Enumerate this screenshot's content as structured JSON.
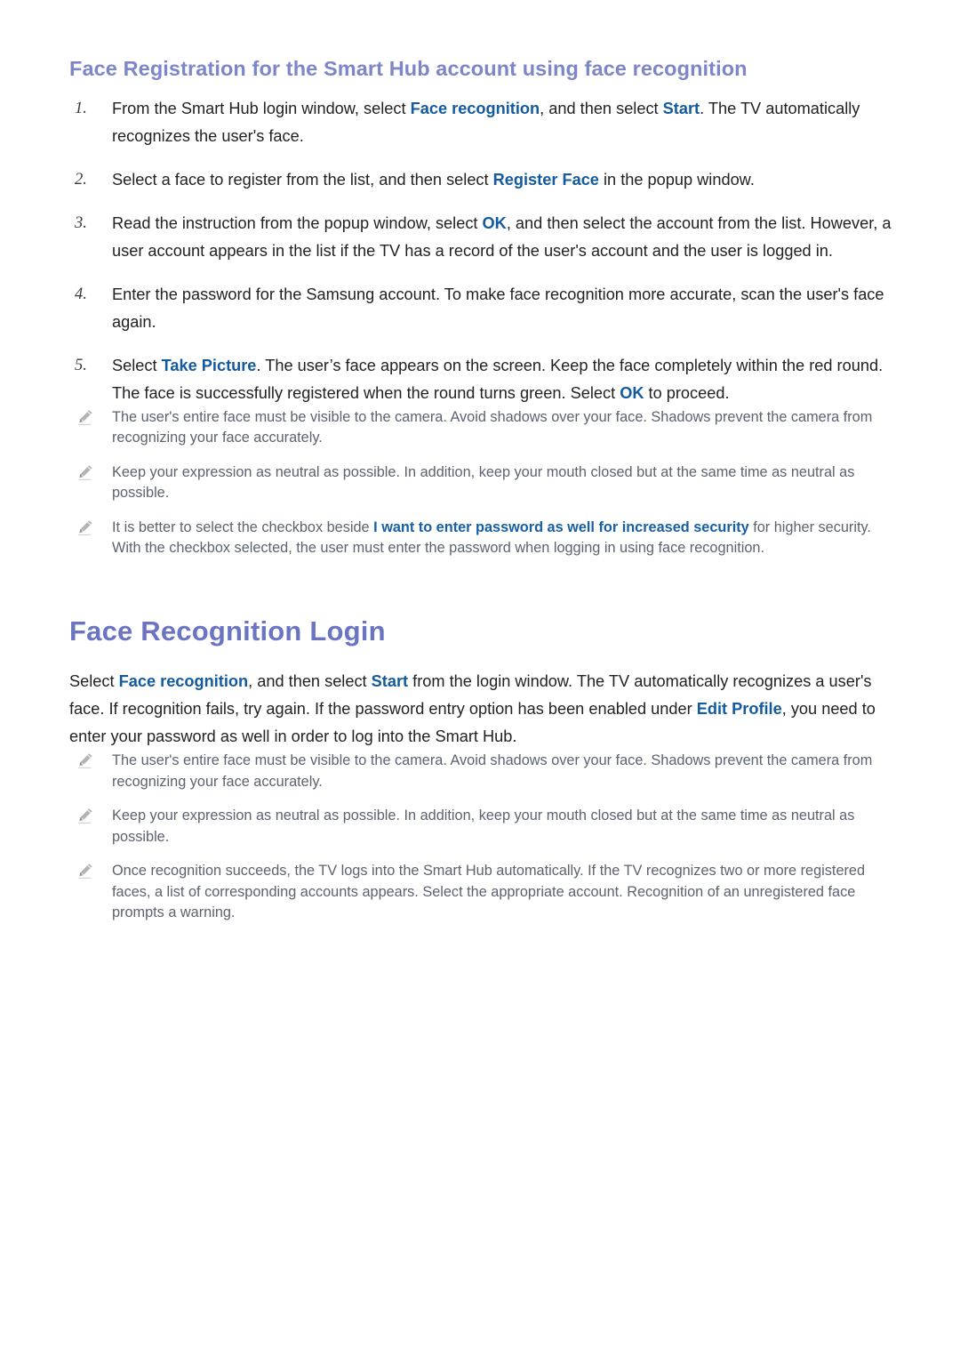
{
  "colors": {
    "heading1": "#7c86c8",
    "heading2": "#6a74c2",
    "body": "#222222",
    "note": "#5c6270",
    "link": "#135a9e",
    "background": "#ffffff"
  },
  "section1": {
    "heading": "Face Registration for the Smart Hub account using face recognition",
    "steps": [
      {
        "marker": "1.",
        "parts": [
          {
            "text": "From the Smart Hub login window, select ",
            "style": "normal"
          },
          {
            "text": "Face recognition",
            "style": "link"
          },
          {
            "text": ", and then select ",
            "style": "normal"
          },
          {
            "text": "Start",
            "style": "link"
          },
          {
            "text": ". The TV automatically recognizes the user's face.",
            "style": "normal"
          }
        ]
      },
      {
        "marker": "2.",
        "parts": [
          {
            "text": "Select a face to register from the list, and then select ",
            "style": "normal"
          },
          {
            "text": "Register Face",
            "style": "link"
          },
          {
            "text": " in the popup window.",
            "style": "normal"
          }
        ]
      },
      {
        "marker": "3.",
        "parts": [
          {
            "text": "Read the instruction from the popup window, select ",
            "style": "normal"
          },
          {
            "text": "OK",
            "style": "link"
          },
          {
            "text": ", and then select the account from the list. However, a user account appears in the list if the TV has a record of the user's account and the user is logged in.",
            "style": "normal"
          }
        ]
      },
      {
        "marker": "4.",
        "parts": [
          {
            "text": "Enter the password for the Samsung account. To make face recognition more accurate, scan the user's face again.",
            "style": "normal"
          }
        ]
      },
      {
        "marker": "5.",
        "parts": [
          {
            "text": "Select ",
            "style": "normal"
          },
          {
            "text": "Take Picture",
            "style": "link"
          },
          {
            "text": ". The user’s face appears on the screen. Keep the face completely within the red round. The face is successfully registered when the round turns green. Select ",
            "style": "normal"
          },
          {
            "text": "OK",
            "style": "link"
          },
          {
            "text": " to proceed.",
            "style": "normal"
          }
        ]
      }
    ],
    "notes": [
      {
        "icon": "pencil-icon",
        "parts": [
          {
            "text": "The user's entire face must be visible to the camera. Avoid shadows over your face. Shadows prevent the camera from recognizing your face accurately.",
            "style": "normal"
          }
        ]
      },
      {
        "icon": "pencil-icon",
        "parts": [
          {
            "text": "Keep your expression as neutral as possible. In addition, keep your mouth closed but at the same time as neutral as possible.",
            "style": "normal"
          }
        ]
      },
      {
        "icon": "pencil-icon",
        "parts": [
          {
            "text": "It is better to select the checkbox beside ",
            "style": "normal"
          },
          {
            "text": "I want to enter password as well for increased security",
            "style": "link"
          },
          {
            "text": " for higher security. With the checkbox selected, the user must enter the password when logging in using face recognition.",
            "style": "normal"
          }
        ]
      }
    ]
  },
  "section2": {
    "heading": "Face Recognition Login",
    "paragraph": [
      {
        "text": "Select ",
        "style": "normal"
      },
      {
        "text": "Face recognition",
        "style": "link"
      },
      {
        "text": ", and then select ",
        "style": "normal"
      },
      {
        "text": "Start",
        "style": "link"
      },
      {
        "text": " from the login window. The TV automatically recognizes a user's face. If recognition fails, try again. If the password entry option has been enabled under ",
        "style": "normal"
      },
      {
        "text": "Edit Profile",
        "style": "link"
      },
      {
        "text": ", you need to enter your password as well in order to log into the Smart Hub.",
        "style": "normal"
      }
    ],
    "notes": [
      {
        "icon": "pencil-icon",
        "parts": [
          {
            "text": "The user's entire face must be visible to the camera. Avoid shadows over your face. Shadows prevent the camera from recognizing your face accurately.",
            "style": "normal"
          }
        ]
      },
      {
        "icon": "pencil-icon",
        "parts": [
          {
            "text": "Keep your expression as neutral as possible. In addition, keep your mouth closed but at the same time as neutral as possible.",
            "style": "normal"
          }
        ]
      },
      {
        "icon": "pencil-icon",
        "parts": [
          {
            "text": "Once recognition succeeds, the TV logs into the Smart Hub automatically. If the TV recognizes two or more registered faces, a list of corresponding accounts appears. Select the appropriate account. Recognition of an unregistered face prompts a warning.",
            "style": "normal"
          }
        ]
      }
    ]
  }
}
